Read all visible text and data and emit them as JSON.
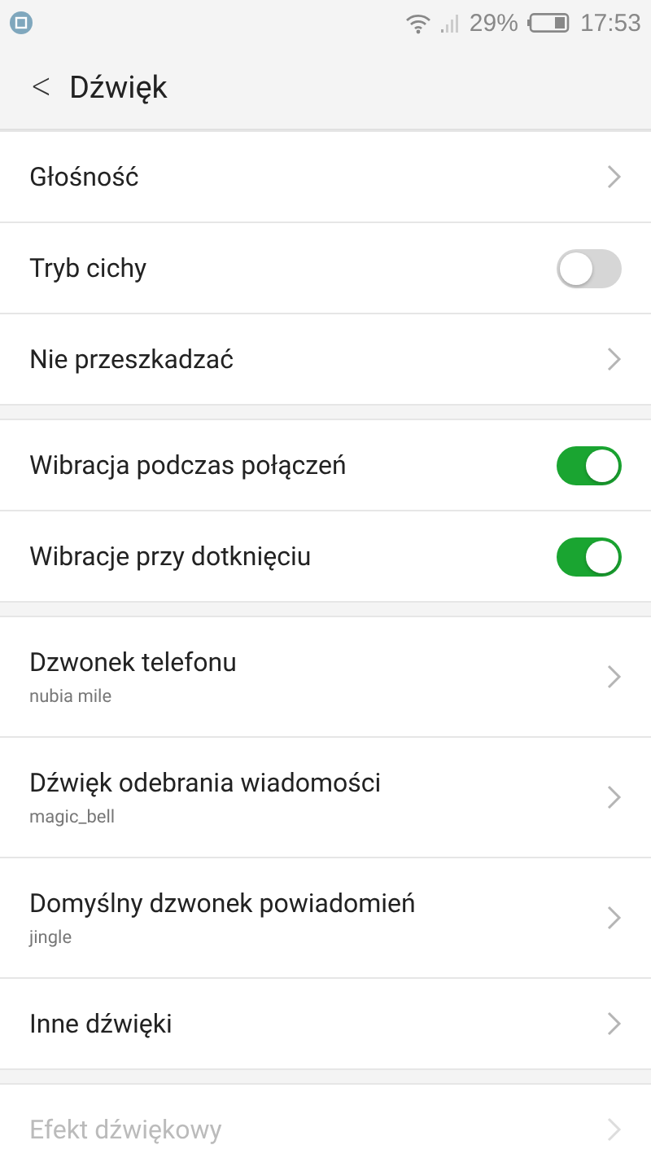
{
  "status_bar": {
    "battery": "29%",
    "time": "17:53"
  },
  "header": {
    "back": "<",
    "title": "Dźwięk"
  },
  "sections": [
    {
      "items": [
        {
          "kind": "link",
          "label": "Głośność",
          "disabled": false
        },
        {
          "kind": "toggle",
          "label": "Tryb cichy",
          "on": false,
          "disabled": false
        },
        {
          "kind": "link",
          "label": "Nie przeszkadzać",
          "disabled": false
        }
      ]
    },
    {
      "items": [
        {
          "kind": "toggle",
          "label": "Wibracja podczas połączeń",
          "on": true,
          "disabled": false
        },
        {
          "kind": "toggle",
          "label": "Wibracje przy dotknięciu",
          "on": true,
          "disabled": false
        }
      ]
    },
    {
      "items": [
        {
          "kind": "link",
          "label": "Dzwonek telefonu",
          "subtitle": "nubia mile",
          "disabled": false
        },
        {
          "kind": "link",
          "label": "Dźwięk odebrania wiadomości",
          "subtitle": "magic_bell",
          "disabled": false
        },
        {
          "kind": "link",
          "label": "Domyślny dzwonek powiadomień",
          "subtitle": "jingle",
          "disabled": false
        },
        {
          "kind": "link",
          "label": "Inne dźwięki",
          "disabled": false
        }
      ]
    },
    {
      "items": [
        {
          "kind": "link",
          "label": "Efekt dźwiękowy",
          "disabled": true
        }
      ]
    }
  ]
}
